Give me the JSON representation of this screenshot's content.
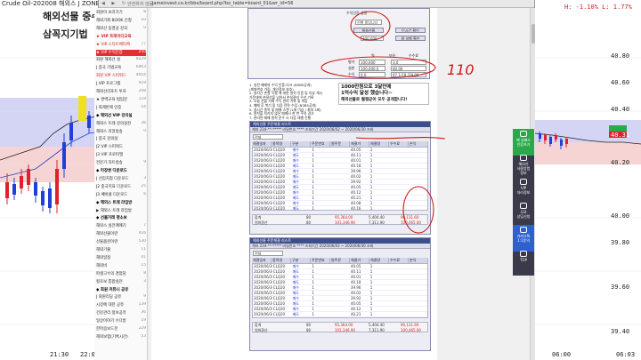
{
  "chart": {
    "title": "Crude Oil-202008 해외스 J ZONE",
    "overlay_line1": "해외선물 중수",
    "overlay_line2": "삼꼭지기법",
    "top_right_readout": "H: -1.10%  L: 1.77%",
    "left_price_labels": [
      "40.80",
      "40.60",
      "40.40",
      "40.20",
      "40.00",
      "39.80",
      "39.60",
      "39.40"
    ],
    "right_price_labels": [
      "40.80",
      "40.60",
      "40.40",
      "40.31",
      "40.20",
      "40.00",
      "39.80",
      "39.60",
      "39.40"
    ],
    "time_labels_left": [
      "21:30",
      "22:00"
    ],
    "time_labels_right": [
      "06:00",
      "06:03"
    ],
    "colors": {
      "up": "#1e3fd8",
      "down": "#e0202a",
      "band": "#c8c8f0",
      "envelope": "#f2c8c8"
    }
  },
  "browser": {
    "nav_glyphs": "◀ ▶ ↻",
    "secure_label": "안전하지 않음",
    "url": "jameinvest.co.kr/bbs/board.php?bo_table=board_01&wr_id=56"
  },
  "sidebar": {
    "items": [
      {
        "label": "회원이 보러가기",
        "count": "8"
      },
      {
        "label": "해외기회 BOOK 신청",
        "count": "10"
      },
      {
        "label": "해외선 동영상 강의",
        "count": "0"
      },
      {
        "label": "★ VIP 트레이더교육",
        "count": "",
        "head": true,
        "hot": true
      },
      {
        "label": "★ VIP 스타트배타팩",
        "count": "77",
        "hot": true
      },
      {
        "label": "★ VIP 수익인증",
        "count": "250",
        "active": true
      },
      {
        "label": "회원 해외선 실",
        "count": "8229"
      },
      {
        "label": "J 중국 기법교육",
        "count": "6463"
      },
      {
        "label": "회원 VIP 스피워드",
        "count": "4054",
        "hot": true
      },
      {
        "label": "J VIP 프로그램",
        "count": "919"
      },
      {
        "label": "해외선리포트 투자",
        "count": "208"
      },
      {
        "label": "★ 완벽교육 법입문",
        "count": "119"
      },
      {
        "label": "J 회계반에 인증",
        "count": "54"
      },
      {
        "label": "◆ 해외선 VIP 강의실",
        "count": "",
        "head": true
      },
      {
        "label": "해외스 트레 강의실천",
        "count": "36"
      },
      {
        "label": "해외스 리얼방송",
        "count": "0"
      },
      {
        "label": "J 중국 강의실",
        "count": ""
      },
      {
        "label": "J2 VIP 스피워드",
        "count": ""
      },
      {
        "label": "J3 VIP 프로피엘",
        "count": ""
      },
      {
        "label": "전문가 차트방송",
        "count": "9"
      },
      {
        "label": "◆ 미장쌍 다운로드",
        "count": "",
        "head": true
      },
      {
        "label": "J 선입지점 다운로드",
        "count": "3"
      },
      {
        "label": "J2 중국지표 다운로드",
        "count": "25"
      },
      {
        "label": "J3 쎄바클 다운로드",
        "count": "6"
      },
      {
        "label": "◆ 해외스 트레 라임방",
        "count": "",
        "head": true
      },
      {
        "label": "▶ 해외스 트레 라임방",
        "count": ""
      },
      {
        "label": "◆ 선물거래 평소보",
        "count": "",
        "head": true
      },
      {
        "label": "해외스 실전매매기",
        "count": "7"
      },
      {
        "label": "해외선물이란",
        "count": "416"
      },
      {
        "label": "선물옵션이란",
        "count": "530"
      },
      {
        "label": "해외기출",
        "count": "11"
      },
      {
        "label": "해외일정",
        "count": "41"
      },
      {
        "label": "해외비",
        "count": "15"
      },
      {
        "label": "파생고수의 경험담",
        "count": "8"
      },
      {
        "label": "평조보 통합실전",
        "count": "3"
      },
      {
        "label": "◆ 회원 커뮤니 공유",
        "count": "",
        "head": true
      },
      {
        "label": "J 회원리딩 공유",
        "count": "9"
      },
      {
        "label": "시장에 대한 공유",
        "count": "139"
      },
      {
        "label": "건강관리 정보공유",
        "count": "36"
      },
      {
        "label": "일상이야기 수다방",
        "count": "19"
      },
      {
        "label": "한마음보드분",
        "count": "229"
      },
      {
        "label": "해외보험(기록시간)",
        "count": "53"
      }
    ]
  },
  "settings_panel": {
    "title": "수익인증 설정",
    "dropdown_label": "진행 중입니다",
    "value_box": "100,000",
    "label_a": "통화선물",
    "label_b": "단시간 확인",
    "label_c": "클 실행 확인",
    "rows": [
      {
        "key": "평가",
        "v1": "100,000",
        "v2": "3.0"
      },
      {
        "key": "실현",
        "v1": "100,000.0",
        "v2": "80.00"
      },
      {
        "key": "수익",
        "v1": "0.0",
        "v2": "97.1/18,/28,00"
      }
    ],
    "col_headers": [
      "원",
      "보유",
      "수수료"
    ]
  },
  "notes": [
    "1. 실전 매매의 수익 인증-다크 (N3B5공개)",
    "(계좌번호 가림, 개인정보 보호)",
    "2. 실시간 손절 익절 에 대한 원칙 인증 및 리뷰 게시",
    "가운데에 손절선을 넘어서 손실관리 우선 기록",
    "3. 오늘 선물 거래 수익 관리 기록 및 마감",
    "4. 매매 후 복기 및 다음 전략 수립 (N3B5공개)",
    "5. 실시간 종목 및 매매 스캔 (1회 이상 / 최대 3회)",
    "6. 원칙을 지키지 않은 매매시 한 번 주의 경고",
    "7. 관리된 매매 원칙 준수 시 다음 레벨 진행"
  ],
  "promo": {
    "line1": "1000만원으로 3달만에",
    "line2": "1억수익 달성 했습니다~",
    "line3": "해외선물로 월평균이 모두 공개합니다!"
  },
  "grid1": {
    "title": "해외선물 주문체결 리스트",
    "toolbar": "계좌  234-**-*****  비밀번호 ****  조회기간 2020/06/02 ~ 2020/06/30  조회",
    "filter_label": "전체",
    "headers": [
      "체결일자",
      "종목명",
      "구분",
      "주문번호",
      "원주문",
      "체결가",
      "체결량",
      "수수료",
      "손익"
    ],
    "rows": [
      [
        "2020/06/30",
        "CLQ20",
        "매수",
        "1",
        "",
        "40.05",
        "1",
        "",
        ""
      ],
      [
        "2020/06/30",
        "CLQ20",
        "매도",
        "1",
        "",
        "40.11",
        "1",
        "",
        ""
      ],
      [
        "2020/06/30",
        "CLQ20",
        "매수",
        "1",
        "",
        "40.01",
        "1",
        "",
        ""
      ],
      [
        "2020/06/30",
        "CLQ20",
        "매도",
        "1",
        "",
        "40.18",
        "1",
        "",
        ""
      ],
      [
        "2020/06/30",
        "CLQ20",
        "매수",
        "1",
        "",
        "39.96",
        "1",
        "",
        ""
      ],
      [
        "2020/06/30",
        "CLQ20",
        "매도",
        "1",
        "",
        "40.02",
        "1",
        "",
        ""
      ],
      [
        "2020/06/30",
        "CLQ20",
        "매수",
        "1",
        "",
        "39.92",
        "1",
        "",
        ""
      ],
      [
        "2020/06/30",
        "CLQ20",
        "매도",
        "1",
        "",
        "40.05",
        "1",
        "",
        ""
      ],
      [
        "2020/06/30",
        "CLQ20",
        "매수",
        "1",
        "",
        "40.12",
        "1",
        "",
        ""
      ],
      [
        "2020/06/30",
        "CLQ20",
        "매도",
        "1",
        "",
        "40.21",
        "1",
        "",
        ""
      ],
      [
        "2020/06/30",
        "CLQ20",
        "매수",
        "1",
        "",
        "40.08",
        "1",
        "",
        ""
      ],
      [
        "2020/06/30",
        "CLQ20",
        "매도",
        "1",
        "",
        "40.16",
        "1",
        "",
        ""
      ]
    ],
    "summary_label1": "합계",
    "summary_label2": "원화환산",
    "summary_v1": "80",
    "summary_v2": "80",
    "summary_amt1": "95,364.00",
    "summary_amt2": "101,346.90",
    "summary_fee1": "5,404.40",
    "summary_fee2": "7,311.90",
    "summary_pl1": "90,131.60",
    "summary_pl2": "100,465.00"
  },
  "grid2": {
    "title": "해외선물 주문체결 리스트",
    "toolbar": "계좌  234-**-*****  비밀번호 ****  조회기간 2020/06/02 ~ 2020/06/30  조회",
    "filter_label": "전체",
    "headers": [
      "체결일자",
      "종목명",
      "구분",
      "주문번호",
      "원주문",
      "체결가",
      "체결량",
      "수수료",
      "손익"
    ],
    "rows": [
      [
        "2020/06/30",
        "CLQ20",
        "매수",
        "1",
        "",
        "40.05",
        "1",
        "",
        ""
      ],
      [
        "2020/06/30",
        "CLQ20",
        "매도",
        "1",
        "",
        "40.11",
        "1",
        "",
        ""
      ],
      [
        "2020/06/30",
        "CLQ20",
        "매수",
        "1",
        "",
        "40.01",
        "1",
        "",
        ""
      ],
      [
        "2020/06/30",
        "CLQ20",
        "매도",
        "1",
        "",
        "40.18",
        "1",
        "",
        ""
      ],
      [
        "2020/06/30",
        "CLQ20",
        "매수",
        "1",
        "",
        "39.96",
        "1",
        "",
        ""
      ],
      [
        "2020/06/30",
        "CLQ20",
        "매도",
        "1",
        "",
        "40.02",
        "1",
        "",
        ""
      ],
      [
        "2020/06/30",
        "CLQ20",
        "매수",
        "1",
        "",
        "39.92",
        "1",
        "",
        ""
      ],
      [
        "2020/06/30",
        "CLQ20",
        "매도",
        "1",
        "",
        "40.05",
        "1",
        "",
        ""
      ],
      [
        "2020/06/30",
        "CLQ20",
        "매수",
        "1",
        "",
        "40.12",
        "1",
        "",
        ""
      ],
      [
        "2020/06/30",
        "CLQ20",
        "매도",
        "1",
        "",
        "40.21",
        "1",
        "",
        ""
      ]
    ],
    "summary_label1": "합계",
    "summary_label2": "원화환산",
    "summary_v1": "80",
    "summary_v2": "80",
    "summary_amt1": "95,364.00",
    "summary_amt2": "101,346.90",
    "summary_fee1": "5,404.40",
    "summary_fee2": "7,311.90",
    "summary_pl1": "90,131.60",
    "summary_pl2": "100,465.00"
  },
  "float_bar": {
    "items": [
      {
        "label": "매 실패스\n인증하기",
        "icon": "chat-icon",
        "color": "#2aa84a"
      },
      {
        "label": "해외선\n사용방법\n정보",
        "icon": "doc-icon",
        "color": ""
      },
      {
        "label": "VIP\n자리정보",
        "icon": "hand-icon",
        "color": ""
      },
      {
        "label": "무료\n상담신청",
        "icon": "phone-icon",
        "color": ""
      },
      {
        "label": "카카오톡\n1:1문의",
        "icon": "kakao-icon",
        "color": "#3060d0"
      },
      {
        "label": "TOP",
        "icon": "top-icon",
        "color": ""
      }
    ]
  },
  "annotations": {
    "handwritten_110": "110",
    "color": "#d01818"
  }
}
